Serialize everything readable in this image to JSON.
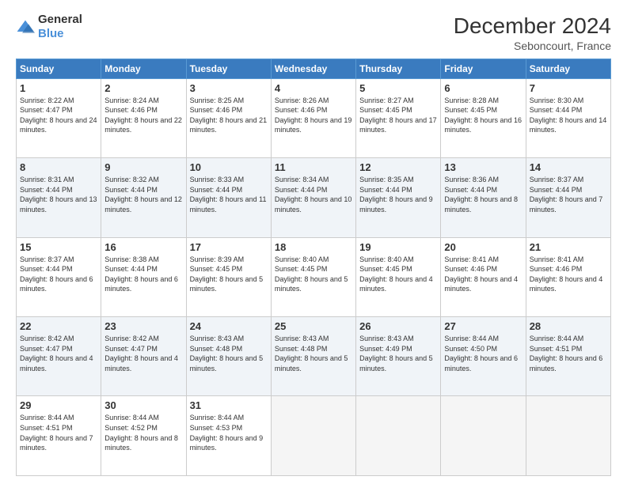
{
  "logo": {
    "general": "General",
    "blue": "Blue"
  },
  "title": "December 2024",
  "subtitle": "Seboncourt, France",
  "days_of_week": [
    "Sunday",
    "Monday",
    "Tuesday",
    "Wednesday",
    "Thursday",
    "Friday",
    "Saturday"
  ],
  "weeks": [
    [
      {
        "day": "1",
        "sunrise": "8:22 AM",
        "sunset": "4:47 PM",
        "daylight": "8 hours and 24 minutes."
      },
      {
        "day": "2",
        "sunrise": "8:24 AM",
        "sunset": "4:46 PM",
        "daylight": "8 hours and 22 minutes."
      },
      {
        "day": "3",
        "sunrise": "8:25 AM",
        "sunset": "4:46 PM",
        "daylight": "8 hours and 21 minutes."
      },
      {
        "day": "4",
        "sunrise": "8:26 AM",
        "sunset": "4:46 PM",
        "daylight": "8 hours and 19 minutes."
      },
      {
        "day": "5",
        "sunrise": "8:27 AM",
        "sunset": "4:45 PM",
        "daylight": "8 hours and 17 minutes."
      },
      {
        "day": "6",
        "sunrise": "8:28 AM",
        "sunset": "4:45 PM",
        "daylight": "8 hours and 16 minutes."
      },
      {
        "day": "7",
        "sunrise": "8:30 AM",
        "sunset": "4:44 PM",
        "daylight": "8 hours and 14 minutes."
      }
    ],
    [
      {
        "day": "8",
        "sunrise": "8:31 AM",
        "sunset": "4:44 PM",
        "daylight": "8 hours and 13 minutes."
      },
      {
        "day": "9",
        "sunrise": "8:32 AM",
        "sunset": "4:44 PM",
        "daylight": "8 hours and 12 minutes."
      },
      {
        "day": "10",
        "sunrise": "8:33 AM",
        "sunset": "4:44 PM",
        "daylight": "8 hours and 11 minutes."
      },
      {
        "day": "11",
        "sunrise": "8:34 AM",
        "sunset": "4:44 PM",
        "daylight": "8 hours and 10 minutes."
      },
      {
        "day": "12",
        "sunrise": "8:35 AM",
        "sunset": "4:44 PM",
        "daylight": "8 hours and 9 minutes."
      },
      {
        "day": "13",
        "sunrise": "8:36 AM",
        "sunset": "4:44 PM",
        "daylight": "8 hours and 8 minutes."
      },
      {
        "day": "14",
        "sunrise": "8:37 AM",
        "sunset": "4:44 PM",
        "daylight": "8 hours and 7 minutes."
      }
    ],
    [
      {
        "day": "15",
        "sunrise": "8:37 AM",
        "sunset": "4:44 PM",
        "daylight": "8 hours and 6 minutes."
      },
      {
        "day": "16",
        "sunrise": "8:38 AM",
        "sunset": "4:44 PM",
        "daylight": "8 hours and 6 minutes."
      },
      {
        "day": "17",
        "sunrise": "8:39 AM",
        "sunset": "4:45 PM",
        "daylight": "8 hours and 5 minutes."
      },
      {
        "day": "18",
        "sunrise": "8:40 AM",
        "sunset": "4:45 PM",
        "daylight": "8 hours and 5 minutes."
      },
      {
        "day": "19",
        "sunrise": "8:40 AM",
        "sunset": "4:45 PM",
        "daylight": "8 hours and 4 minutes."
      },
      {
        "day": "20",
        "sunrise": "8:41 AM",
        "sunset": "4:46 PM",
        "daylight": "8 hours and 4 minutes."
      },
      {
        "day": "21",
        "sunrise": "8:41 AM",
        "sunset": "4:46 PM",
        "daylight": "8 hours and 4 minutes."
      }
    ],
    [
      {
        "day": "22",
        "sunrise": "8:42 AM",
        "sunset": "4:47 PM",
        "daylight": "8 hours and 4 minutes."
      },
      {
        "day": "23",
        "sunrise": "8:42 AM",
        "sunset": "4:47 PM",
        "daylight": "8 hours and 4 minutes."
      },
      {
        "day": "24",
        "sunrise": "8:43 AM",
        "sunset": "4:48 PM",
        "daylight": "8 hours and 5 minutes."
      },
      {
        "day": "25",
        "sunrise": "8:43 AM",
        "sunset": "4:48 PM",
        "daylight": "8 hours and 5 minutes."
      },
      {
        "day": "26",
        "sunrise": "8:43 AM",
        "sunset": "4:49 PM",
        "daylight": "8 hours and 5 minutes."
      },
      {
        "day": "27",
        "sunrise": "8:44 AM",
        "sunset": "4:50 PM",
        "daylight": "8 hours and 6 minutes."
      },
      {
        "day": "28",
        "sunrise": "8:44 AM",
        "sunset": "4:51 PM",
        "daylight": "8 hours and 6 minutes."
      }
    ],
    [
      {
        "day": "29",
        "sunrise": "8:44 AM",
        "sunset": "4:51 PM",
        "daylight": "8 hours and 7 minutes."
      },
      {
        "day": "30",
        "sunrise": "8:44 AM",
        "sunset": "4:52 PM",
        "daylight": "8 hours and 8 minutes."
      },
      {
        "day": "31",
        "sunrise": "8:44 AM",
        "sunset": "4:53 PM",
        "daylight": "8 hours and 9 minutes."
      },
      null,
      null,
      null,
      null
    ]
  ],
  "labels": {
    "sunrise": "Sunrise:",
    "sunset": "Sunset:",
    "daylight": "Daylight:"
  }
}
